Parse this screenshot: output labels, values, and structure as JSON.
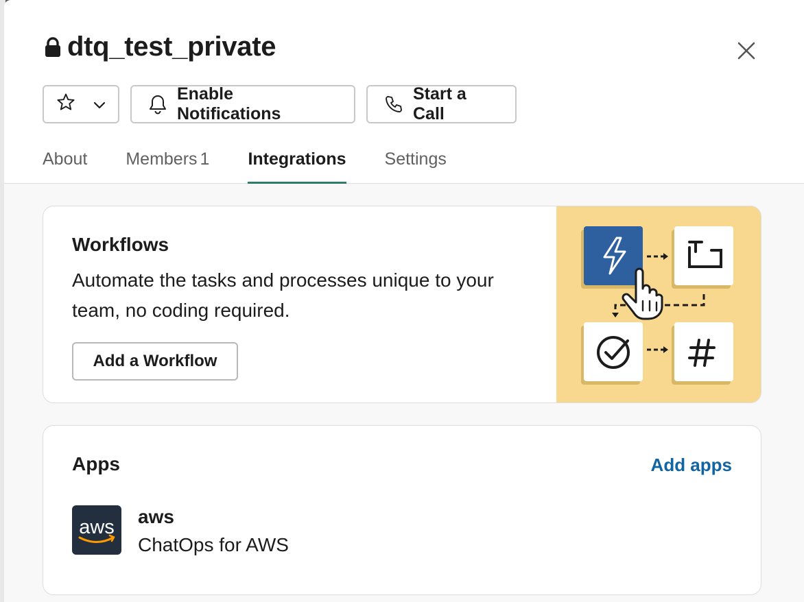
{
  "channel": {
    "name": "dtq_test_private",
    "lock_icon": "lock-icon"
  },
  "header_buttons": {
    "star_icon": "star-icon",
    "chevron_icon": "chevron-down-icon",
    "notifications_label": "Enable Notifications",
    "call_label": "Start a Call"
  },
  "tabs": [
    {
      "label": "About",
      "count": ""
    },
    {
      "label": "Members",
      "count": "1"
    },
    {
      "label": "Integrations",
      "count": "",
      "active": true
    },
    {
      "label": "Settings",
      "count": ""
    }
  ],
  "workflows": {
    "title": "Workflows",
    "description": "Automate the tasks and processes unique to your team, no coding required.",
    "button_label": "Add a Workflow",
    "illustration_bg": "#f8d88f",
    "tile_accent": "#2e5f9e"
  },
  "apps": {
    "title": "Apps",
    "add_label": "Add apps",
    "items": [
      {
        "name": "aws",
        "description": "ChatOps for AWS",
        "logo_text": "aws"
      }
    ]
  },
  "colors": {
    "link": "#1264a3",
    "tab_underline": "#2e7d6b",
    "aws_logo_bg": "#232f3e",
    "aws_smile": "#ff9900"
  }
}
